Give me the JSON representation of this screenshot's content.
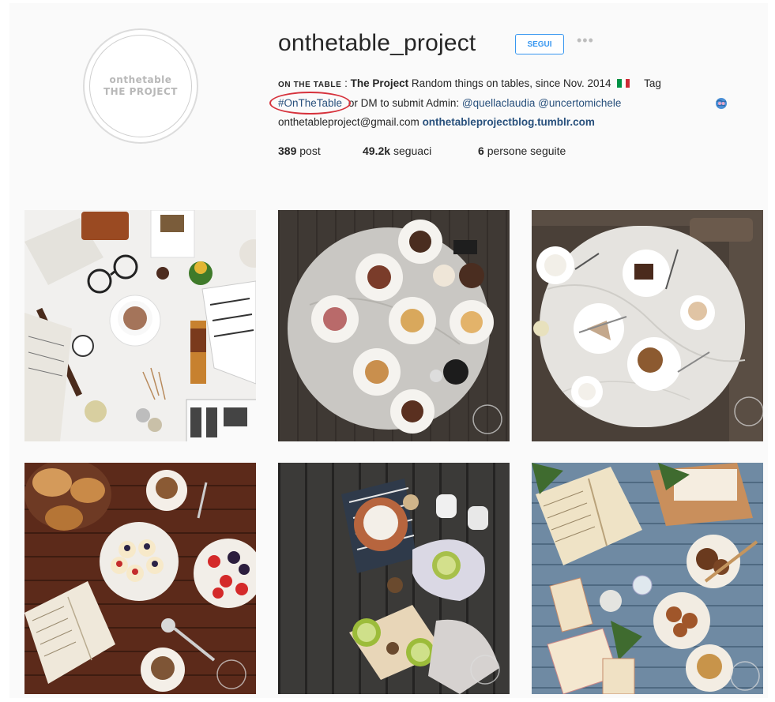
{
  "profile": {
    "avatar_text_line1": "onthetable",
    "avatar_text_line2": "THE PROJECT",
    "username": "onthetable_project",
    "follow_label": "SEGUI",
    "more_label": "•••",
    "bio": {
      "name": "ON THE TABLE",
      "sep": " : ",
      "title": "The Project",
      "text1": " Random things on tables, since Nov. 2014",
      "tag_label": "Tag",
      "hashtag": "#OnTheTable",
      "text2": " or DM to submit Admin: ",
      "mention1": "@quellaclaudia",
      "mention2": "@uncertomichele",
      "email": "onthetableproject@gmail.com",
      "website": "onthetableprojectblog.tumblr.com"
    },
    "stats": {
      "posts_count": "389",
      "posts_label": "post",
      "followers_count": "49.2k",
      "followers_label": "seguaci",
      "following_count": "6",
      "following_label": "persone seguite"
    }
  },
  "colors": {
    "accent_blue": "#3897f0",
    "link_blue": "#28507c",
    "annotation_red": "#d6323c",
    "flag": [
      "#009246",
      "#ffffff",
      "#ce2b37"
    ]
  },
  "icons": {
    "tag_icon": "globe-people-icon",
    "more_icon": "ellipsis-icon"
  },
  "posts": [
    {
      "id": "post-1",
      "description_icon": "flatlay-coffee-newspaper-glasses-watch"
    },
    {
      "id": "post-2",
      "description_icon": "round-marble-table-desserts"
    },
    {
      "id": "post-3",
      "description_icon": "oval-marble-table-cake-coffee"
    },
    {
      "id": "post-4",
      "description_icon": "wooden-table-pastries-strawberries-book"
    },
    {
      "id": "post-5",
      "description_icon": "dark-wood-table-limes-bowl"
    },
    {
      "id": "post-6",
      "description_icon": "blue-wood-table-book-cookies"
    }
  ]
}
